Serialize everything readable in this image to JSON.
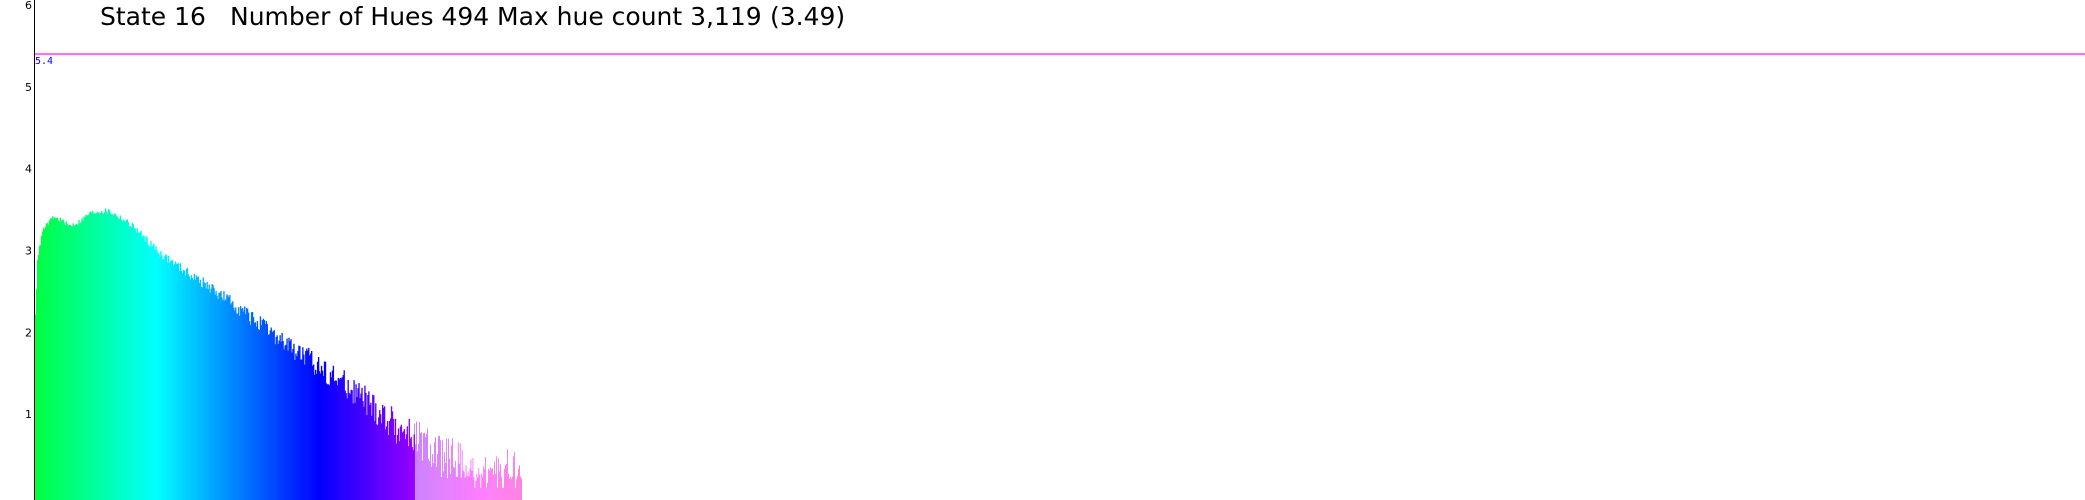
{
  "chart_data": {
    "type": "bar",
    "title_parts": [
      "State 16",
      "Number of Hues 494",
      "Max hue count 3,119",
      "(3.49)"
    ],
    "xlabel": "",
    "ylabel": "",
    "ylim": [
      0,
      6
    ],
    "yticks": [
      "1",
      "2",
      "3",
      "4",
      "5",
      "6"
    ],
    "grid": false,
    "legend": "none",
    "log_scale_y": true,
    "reference_line": {
      "value": 5.4,
      "label": "5.4",
      "color": "#ff66ff"
    },
    "bar_count": 494,
    "hue_gradient": {
      "start_hue": 135,
      "end_hue": 315,
      "stops": [
        "#00ff55",
        "#00ffff",
        "#0000ff",
        "#9900ff",
        "#ff00ff"
      ]
    },
    "profile_x": [
      0,
      0.004,
      0.015,
      0.035,
      0.05,
      0.07,
      0.09,
      0.11,
      0.13,
      0.15,
      0.17,
      0.2,
      0.23,
      0.26,
      0.3,
      0.35,
      0.4,
      0.45,
      0.5,
      0.55,
      0.6,
      0.65,
      0.7,
      0.75,
      0.8,
      0.85,
      0.9,
      0.95,
      1.0
    ],
    "profile_y": [
      2.2,
      2.9,
      3.25,
      3.4,
      3.38,
      3.3,
      3.35,
      3.45,
      3.48,
      3.48,
      3.42,
      3.3,
      3.12,
      2.95,
      2.78,
      2.58,
      2.38,
      2.15,
      1.92,
      1.72,
      1.52,
      1.32,
      1.05,
      0.82,
      0.62,
      0.45,
      0.33,
      0.25,
      0.2
    ]
  }
}
